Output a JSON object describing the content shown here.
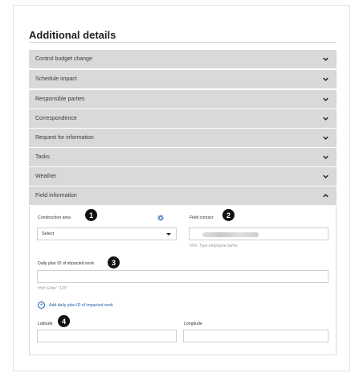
{
  "heading": "Additional details",
  "accordion": [
    {
      "label": "Control budget change",
      "expanded": false
    },
    {
      "label": "Schedule impact",
      "expanded": false
    },
    {
      "label": "Responsible parties",
      "expanded": false
    },
    {
      "label": "Correspondence",
      "expanded": false
    },
    {
      "label": "Request for information",
      "expanded": false
    },
    {
      "label": "Tasks",
      "expanded": false
    },
    {
      "label": "Weather",
      "expanded": false
    },
    {
      "label": "Field information",
      "expanded": true
    }
  ],
  "field_info": {
    "construction_area": {
      "label": "Construction area",
      "value": "Select"
    },
    "field_contact": {
      "label": "Field contact",
      "hint": "Hint: Type employee name"
    },
    "daily_plan": {
      "label": "Daily plan ID of impacted work",
      "hint": "Hint: Enter \"123\""
    },
    "add_daily_plan_label": "Add daily plan ID of impacted work",
    "latitude": {
      "label": "Latitude"
    },
    "longitude": {
      "label": "Longitude"
    }
  },
  "badges": [
    "1",
    "2",
    "3",
    "4"
  ],
  "colors": {
    "accordion_bg": "#d9d9d9",
    "link": "#1d5fa8",
    "badge": "#111111"
  },
  "icons": {
    "collapsed": "chevron-down-icon",
    "expanded": "chevron-up-icon",
    "settings": "gear-icon",
    "add": "plus-circle-icon"
  }
}
